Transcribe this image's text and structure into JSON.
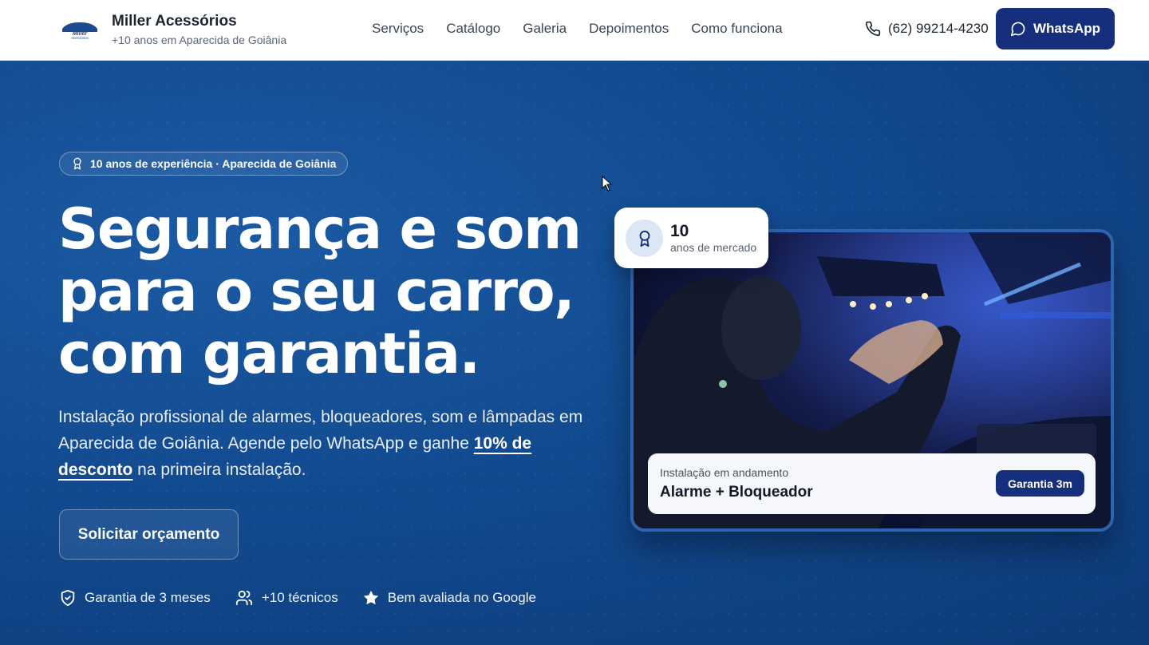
{
  "header": {
    "brand_name": "Miller Acessórios",
    "brand_tagline": "+10 anos em Aparecida de Goiânia",
    "logo_text": "Miller Acessórios",
    "nav": [
      "Serviços",
      "Catálogo",
      "Galeria",
      "Depoimentos",
      "Como funciona"
    ],
    "phone": "(62) 99214-4230",
    "whatsapp_label": "WhatsApp"
  },
  "hero": {
    "badge": "10 anos de experiência · Aparecida de Goiânia",
    "headline_line1": "Segurança e som",
    "headline_line2": "para o seu carro,",
    "headline_line3": "com garantia.",
    "lede_part1": "Instalação profissional de alarmes, bloqueadores, som e lâmpadas em Aparecida de Goiânia. Agende pelo WhatsApp e ganhe ",
    "lede_highlight": "10% de desconto",
    "lede_part2": " na primeira instalação.",
    "cta_label": "Solicitar orçamento",
    "features": [
      "Garantia de 3 meses",
      "+10 técnicos",
      "Bem avaliada no Google"
    ]
  },
  "showcase": {
    "stat_number": "10",
    "stat_label": "anos de mercado",
    "status_caption": "Instalação em andamento",
    "status_title": "Alarme + Bloqueador",
    "status_pill": "Garantia 3m"
  },
  "colors": {
    "primary": "#152f7c",
    "hero_bg": "#124a8f"
  },
  "icons": [
    "logo",
    "phone-icon",
    "whatsapp-icon",
    "award-icon",
    "shield-icon",
    "users-icon",
    "star-icon"
  ]
}
